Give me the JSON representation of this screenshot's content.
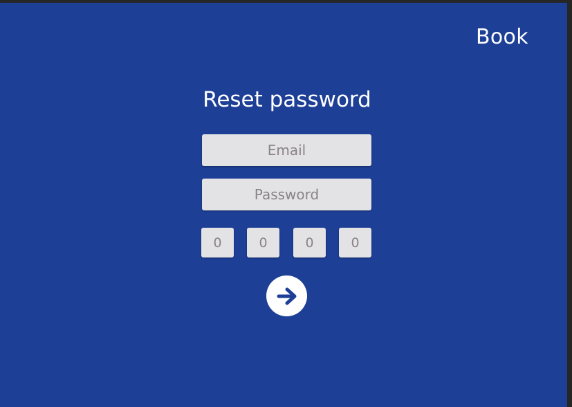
{
  "header": {
    "brand": "Book"
  },
  "form": {
    "title": "Reset password",
    "email_placeholder": "Email",
    "password_placeholder": "Password",
    "code_digits": [
      "0",
      "0",
      "0",
      "0"
    ],
    "submit_icon": "arrow-right-icon"
  },
  "colors": {
    "background": "#1d3f96",
    "field": "#e3e3e6",
    "placeholder": "#8a8384",
    "text": "#ffffff",
    "frame": "#262626"
  }
}
